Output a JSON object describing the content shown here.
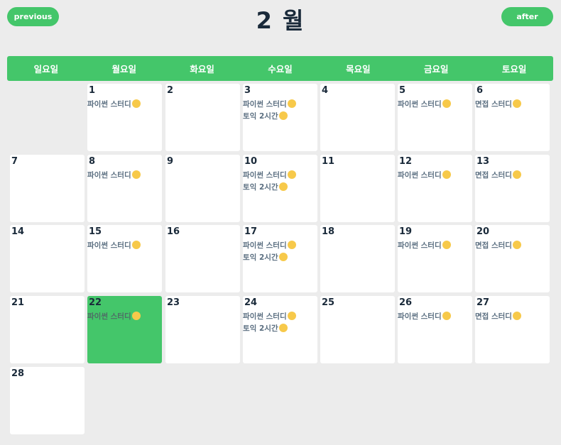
{
  "header": {
    "prev_label": "previous",
    "next_label": "after",
    "month_title": "2 월"
  },
  "weekdays": [
    "일요일",
    "월요일",
    "화요일",
    "수요일",
    "목요일",
    "금요일",
    "토요일"
  ],
  "days": [
    {
      "num": "1",
      "events": [
        "파이썬 스터디"
      ]
    },
    {
      "num": "2",
      "events": []
    },
    {
      "num": "3",
      "events": [
        "파이썬 스터디",
        "토익 2시간"
      ]
    },
    {
      "num": "4",
      "events": []
    },
    {
      "num": "5",
      "events": [
        "파이썬 스터디"
      ]
    },
    {
      "num": "6",
      "events": [
        "면접 스터디"
      ]
    },
    {
      "num": "7",
      "events": []
    },
    {
      "num": "8",
      "events": [
        "파이썬 스터디"
      ]
    },
    {
      "num": "9",
      "events": []
    },
    {
      "num": "10",
      "events": [
        "파이썬 스터디",
        "토익 2시간"
      ]
    },
    {
      "num": "11",
      "events": []
    },
    {
      "num": "12",
      "events": [
        "파이썬 스터디"
      ]
    },
    {
      "num": "13",
      "events": [
        "면접 스터디"
      ]
    },
    {
      "num": "14",
      "events": []
    },
    {
      "num": "15",
      "events": [
        "파이썬 스터디"
      ]
    },
    {
      "num": "16",
      "events": []
    },
    {
      "num": "17",
      "events": [
        "파이썬 스터디",
        "토익 2시간"
      ]
    },
    {
      "num": "18",
      "events": []
    },
    {
      "num": "19",
      "events": [
        "파이썬 스터디"
      ]
    },
    {
      "num": "20",
      "events": [
        "면접 스터디"
      ]
    },
    {
      "num": "21",
      "events": []
    },
    {
      "num": "22",
      "events": [
        "파이썬 스터디"
      ],
      "today": true
    },
    {
      "num": "23",
      "events": []
    },
    {
      "num": "24",
      "events": [
        "파이썬 스터디",
        "토익 2시간"
      ]
    },
    {
      "num": "25",
      "events": []
    },
    {
      "num": "26",
      "events": [
        "파이썬 스터디"
      ]
    },
    {
      "num": "27",
      "events": [
        "면접 스터디"
      ]
    },
    {
      "num": "28",
      "events": []
    }
  ],
  "first_weekday_index": 1,
  "event_emoji": "grinning-face-icon",
  "colors": {
    "accent": "#44c66a",
    "text": "#1a2a3a",
    "event_text": "#5a6e80",
    "background": "#ececec"
  }
}
